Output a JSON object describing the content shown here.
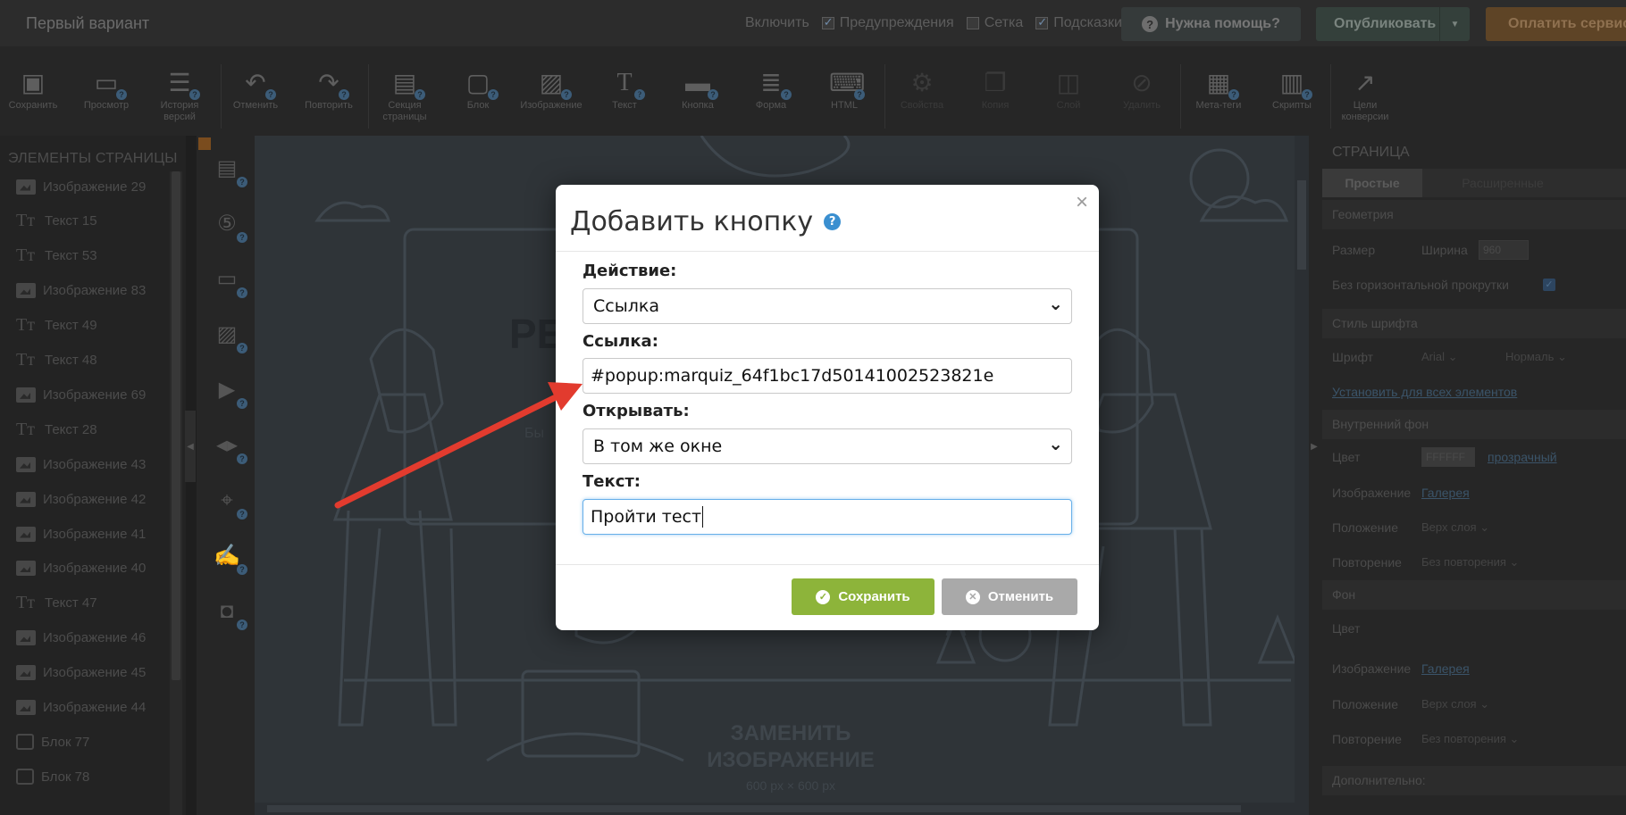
{
  "header": {
    "doc_title": "Первый вариант",
    "enable_label": "Включить",
    "warnings_label": "Предупреждения",
    "grid_label": "Сетка",
    "hints_label": "Подсказки",
    "help_label": "Нужна помощь?",
    "publish_label": "Опубликовать",
    "pay_label": "Оплатить сервис"
  },
  "toolbar": {
    "save": "Сохранить",
    "preview": "Просмотр",
    "history_1": "История",
    "history_2": "версий",
    "undo": "Отменить",
    "redo": "Повторить",
    "section_1": "Секция",
    "section_2": "страницы",
    "block": "Блок",
    "image": "Изображение",
    "text": "Текст",
    "button": "Кнопка",
    "form": "Форма",
    "html": "HTML",
    "props": "Свойства",
    "copy": "Копия",
    "stack": "Слой",
    "delete": "Удалить",
    "meta": "Мета-теги",
    "scripts": "Скрипты",
    "goals_1": "Цели",
    "goals_2": "конверсии"
  },
  "sidebar": {
    "title": "ЭЛЕМЕНТЫ СТРАНИЦЫ",
    "items": [
      {
        "type": "image",
        "label": "Изображение 29"
      },
      {
        "type": "text",
        "label": "Текст 15"
      },
      {
        "type": "text",
        "label": "Текст 53"
      },
      {
        "type": "image",
        "label": "Изображение 83"
      },
      {
        "type": "text",
        "label": "Текст 49"
      },
      {
        "type": "text",
        "label": "Текст 48"
      },
      {
        "type": "image",
        "label": "Изображение 69"
      },
      {
        "type": "text",
        "label": "Текст 28"
      },
      {
        "type": "image",
        "label": "Изображение 43"
      },
      {
        "type": "image",
        "label": "Изображение 42"
      },
      {
        "type": "image",
        "label": "Изображение 41"
      },
      {
        "type": "image",
        "label": "Изображение 40"
      },
      {
        "type": "text",
        "label": "Текст 47"
      },
      {
        "type": "image",
        "label": "Изображение 46"
      },
      {
        "type": "image",
        "label": "Изображение 45"
      },
      {
        "type": "image",
        "label": "Изображение 44"
      },
      {
        "type": "block",
        "label": "Блок 77"
      },
      {
        "type": "block",
        "label": "Блок 78"
      }
    ]
  },
  "canvas": {
    "heading": "РЕ",
    "sub": "Бы",
    "replace_1": "ЗАМЕНИТЬ",
    "replace_2": "ИЗОБРАЖЕНИЕ",
    "replace_size": "600 px × 600 px"
  },
  "right_panel": {
    "title": "СТРАНИЦА",
    "tab_simple": "Простые",
    "tab_advanced": "Расширенные",
    "geometry": "Геометрия",
    "size_label": "Размер",
    "width_label": "Ширина",
    "width_value": "960",
    "no_hscroll": "Без горизонтальной прокрутки",
    "font_style": "Стиль шрифта",
    "font_label": "Шрифт",
    "font_value": "Arial",
    "font_weight": "Нормаль",
    "set_all": "Установить для всех элементов",
    "inner_bg": "Внутренний фон",
    "color_label": "Цвет",
    "color_value": "FFFFFF",
    "transparent": "прозрачный",
    "image_label": "Изображение",
    "gallery": "Галерея",
    "position_label": "Положение",
    "position_value": "Верх слоя",
    "repeat_label": "Повторение",
    "repeat_value": "Без повторения",
    "bg": "Фон",
    "color_label_2": "Цвет",
    "image_label_2": "Изображение",
    "gallery_2": "Галерея",
    "position_label_2": "Положение",
    "position_value_2": "Верх слоя",
    "repeat_label_2": "Повторение",
    "repeat_value_2": "Без повторения",
    "extra": "Дополнительно:"
  },
  "modal": {
    "title": "Добавить кнопку",
    "action_label": "Действие:",
    "action_value": "Ссылка",
    "link_label": "Ссылка:",
    "link_value": "#popup:marquiz_64f1bc17d50141002523821e",
    "open_label": "Открывать:",
    "open_value": "В том же окне",
    "text_label": "Текст:",
    "text_value": "Пройти тест",
    "save_label": "Сохранить",
    "cancel_label": "Отменить"
  },
  "colors": {
    "save_button": "#8db43a",
    "cancel_button": "#a9a9a9",
    "help_icon": "#3a8fd0",
    "annotation_arrow": "#e23b2e"
  }
}
